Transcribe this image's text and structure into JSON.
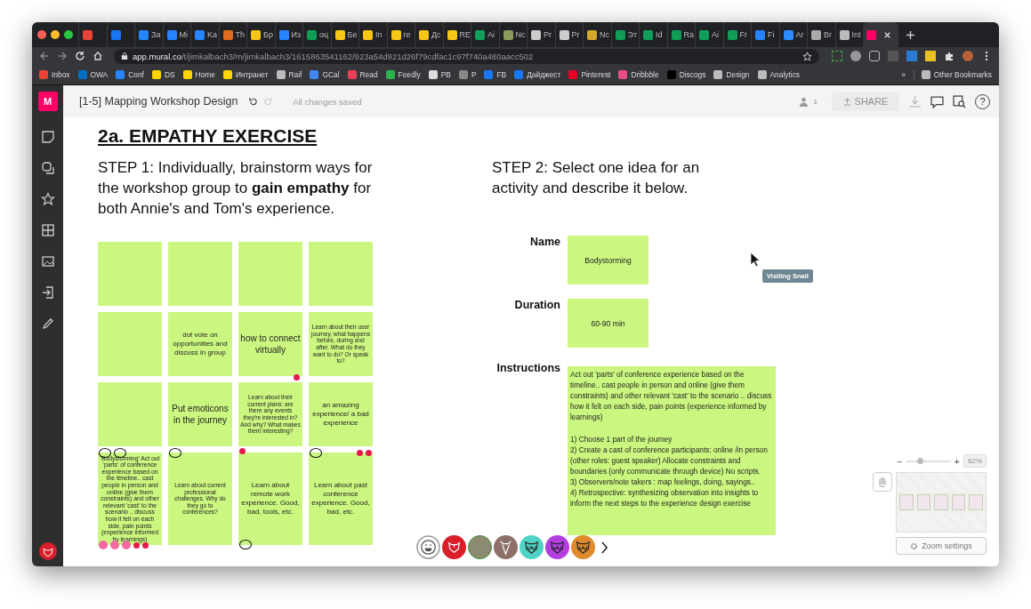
{
  "browser": {
    "tabs": [
      {
        "color": "#ea4335",
        "selected": false
      },
      {
        "color": "#1877f2",
        "selected": false
      },
      {
        "label": "За",
        "color": "#2684ff",
        "selected": false
      },
      {
        "label": "Mi",
        "color": "#2684ff",
        "selected": false
      },
      {
        "label": "Ka",
        "color": "#2684ff",
        "selected": false
      },
      {
        "label": "Th",
        "color": "#e06c1f",
        "selected": false
      },
      {
        "label": "Бр",
        "color": "#f5c518",
        "selected": false
      },
      {
        "label": "Из",
        "color": "#2684ff",
        "selected": false
      },
      {
        "label": "оц",
        "color": "#0f9d58",
        "selected": false
      },
      {
        "label": "Бе",
        "color": "#f5c518",
        "selected": false
      },
      {
        "label": "In",
        "color": "#f5c518",
        "selected": false
      },
      {
        "label": "re",
        "color": "#f5c518",
        "selected": false
      },
      {
        "label": "Дс",
        "color": "#f5c518",
        "selected": false
      },
      {
        "label": "RE",
        "color": "#f5c518",
        "selected": false
      },
      {
        "label": "Ai",
        "color": "#0f9d58",
        "selected": false
      },
      {
        "label": "Nc",
        "color": "#8a9a5b",
        "selected": false
      },
      {
        "label": "Pr",
        "color": "#cccccc",
        "selected": false
      },
      {
        "label": "Pr",
        "color": "#cccccc",
        "selected": false
      },
      {
        "label": "Nc",
        "color": "#d4a72c",
        "selected": false
      },
      {
        "label": "Эт",
        "color": "#0f9d58",
        "selected": false
      },
      {
        "label": "Id",
        "color": "#0f9d58",
        "selected": false
      },
      {
        "label": "Ra",
        "color": "#0f9d58",
        "selected": false
      },
      {
        "label": "Ai",
        "color": "#0f9d58",
        "selected": false
      },
      {
        "label": "Fr",
        "color": "#0f9d58",
        "selected": false
      },
      {
        "label": "Fi",
        "color": "#2684ff",
        "selected": false
      },
      {
        "label": "Ar",
        "color": "#2d8cff",
        "selected": false
      },
      {
        "label": "Br",
        "color": "#aaaaaa",
        "selected": false
      },
      {
        "label": "Int",
        "color": "#bbbbbb",
        "selected": false
      },
      {
        "color": "#ff0066",
        "selected": true
      }
    ],
    "address": {
      "domain": "app.mural.co",
      "path": "/t/jimkalbach3/m/jimkalbach3/1615863541162/923a54d921d26f79cdfac1c97f740a480aacc502"
    },
    "bookmarks": [
      {
        "label": "Inbox",
        "color": "#ea4335"
      },
      {
        "label": "OWA",
        "color": "#0072c6"
      },
      {
        "label": "Conf",
        "color": "#2684ff"
      },
      {
        "label": "DS",
        "color": "#ffd400"
      },
      {
        "label": "Home",
        "color": "#ffd400"
      },
      {
        "label": "Интранет",
        "color": "#ffd400"
      },
      {
        "label": "Raif",
        "color": "#bbbbbb"
      },
      {
        "label": "GCal",
        "color": "#4285f4"
      },
      {
        "label": "Read",
        "color": "#ef3f56"
      },
      {
        "label": "Feedly",
        "color": "#2bb24c"
      },
      {
        "label": "PB",
        "color": "#dddddd"
      },
      {
        "label": "P",
        "color": "#888888"
      },
      {
        "label": "FB",
        "color": "#1877f2"
      },
      {
        "label": "Дайджест",
        "color": "#1877f2"
      },
      {
        "label": "Pinterest",
        "color": "#e60023"
      },
      {
        "label": "Dribbble",
        "color": "#ea4c89"
      },
      {
        "label": "Discogs",
        "color": "#000000"
      },
      {
        "label": "Design",
        "color": "#bbbbbb"
      },
      {
        "label": "Analytics",
        "color": "#bbbbbb"
      }
    ],
    "more": "»",
    "other_bookmarks": "Other Bookmarks"
  },
  "mural": {
    "logo": "M",
    "title": "[1-5] Mapping Workshop Design",
    "save_status": "All changes saved",
    "viewer_count": "1",
    "share": {
      "label": "SHARE",
      "disabled": true
    },
    "help": "?"
  },
  "canvas": {
    "title": "2a. EMPATHY EXERCISE",
    "step1": "STEP 1: Individually, brainstorm ways for the workshop group to **gain empathy** for both Annie's and Tom's experience.",
    "step2": "STEP 2: Select one idea for an activity and describe it below.",
    "stickies": [
      {
        "kind": "empty"
      },
      {
        "kind": "empty"
      },
      {
        "kind": "empty"
      },
      {
        "kind": "empty"
      },
      {
        "kind": "empty"
      },
      {
        "kind": "note",
        "text": "dot vote on opportunities and discuss in group"
      },
      {
        "kind": "note",
        "text": "how to connect virtually",
        "bottom_marks": [
          {
            "kind": "dot"
          }
        ]
      },
      {
        "kind": "note",
        "text": "Learn about their user journey, what happens before, during and after. What do they want to do? Or speak to?"
      },
      {
        "kind": "empty"
      },
      {
        "kind": "note",
        "text": "Put emoticons in the journey"
      },
      {
        "kind": "note",
        "text": "Learn about their current plans: are there any events they're interested in? And why? What makes them interesting?"
      },
      {
        "kind": "note",
        "text": "an amazing experience/ a bad experience"
      },
      {
        "kind": "note",
        "text": "'Bodystorming' Act out 'parts' of conference experience based on the timeline.. cast people in person and online (give them constraints) and other relevant 'cast' to the scenario .. discuss how it felt on each side, pain points (experience informed by learnings)",
        "top_marks": [
          {
            "kind": "ring"
          },
          {
            "kind": "ring"
          }
        ],
        "bottom_marks": [
          {
            "kind": "pink"
          },
          {
            "kind": "pink"
          },
          {
            "kind": "pink"
          },
          {
            "kind": "dot"
          },
          {
            "kind": "dot"
          }
        ]
      },
      {
        "kind": "note",
        "text": "Learn about current professional challenges. Why do they go to conferences?",
        "top_marks": [
          {
            "kind": "ring"
          }
        ]
      },
      {
        "kind": "note",
        "text": "Learn about remote work experience. Good, bad, tools, etc.",
        "top_marks": [
          {
            "kind": "dot"
          }
        ],
        "bottom_marks": [
          {
            "kind": "ring"
          }
        ]
      },
      {
        "kind": "note",
        "text": "Learn about past conference experience. Good, bad, etc.",
        "top_marks": [
          {
            "kind": "ring"
          },
          {
            "kind": "dot"
          },
          {
            "kind": "dot"
          }
        ]
      }
    ],
    "fields": [
      {
        "label": "Name",
        "value": "Bodystorming",
        "kind": "short"
      },
      {
        "label": "Duration",
        "value": "60-90 min",
        "kind": "short"
      },
      {
        "label": "Instructions",
        "value": "Act out 'parts' of conference experience based on the timeline.. cast people in person and online (give them constraints) and other relevant 'cast' to the scenario .. discuss how it felt on each side, pain points (experience informed by learnings)\n\n1) Choose 1 part of the journey\n2) Create a cast of conference participants: online /in person (other roles: guest speaker) Allocate constraints and boundaries (only communicate through device) No scripts.\n3) Observers/note takers : map feelings, doing, sayings..\n4) Retrospective: synthesizing observation into insights to inform the next steps to the experience design exercise",
        "kind": "long"
      }
    ],
    "cursor_tag": "Visiting Snail"
  },
  "zoom": {
    "zoom_out": "−",
    "zoom_in": "+",
    "level": 0.3,
    "percent": "62%",
    "settings": "Zoom settings"
  },
  "collaborators": [
    {
      "kind": "emoji"
    },
    {
      "kind": "rhino",
      "color": "#d81f2a"
    },
    {
      "kind": "photo"
    },
    {
      "kind": "goat",
      "color": "#8d7168"
    },
    {
      "kind": "owl",
      "color": "#4fd3c4"
    },
    {
      "kind": "owl",
      "color": "#b43fe0"
    },
    {
      "kind": "owl",
      "color": "#df8a2c"
    }
  ]
}
